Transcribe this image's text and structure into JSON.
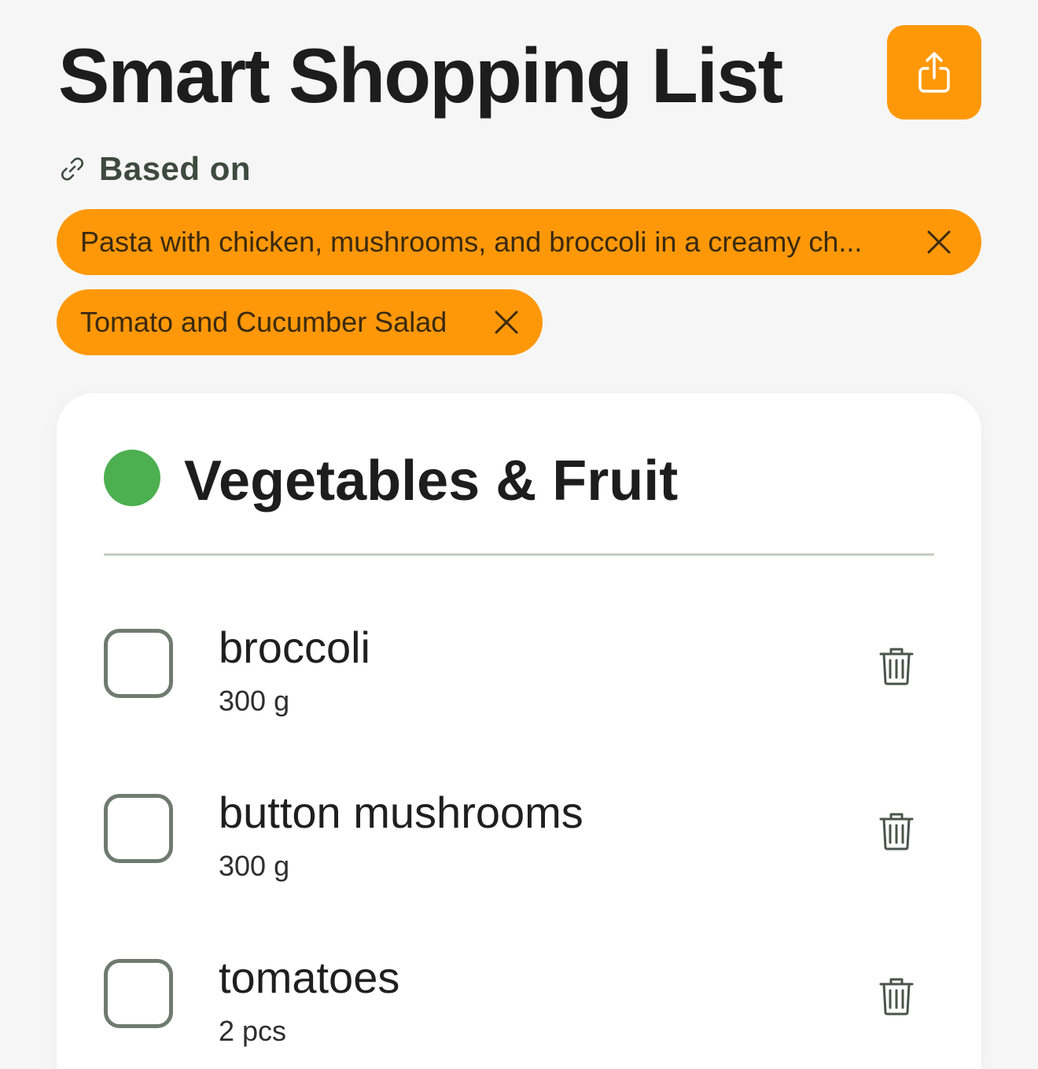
{
  "header": {
    "title": "Smart Shopping List",
    "share_icon": "share-icon",
    "accent_color": "#ff9808"
  },
  "based_on": {
    "label": "Based on",
    "icon": "link-icon",
    "recipes": [
      {
        "label": "Pasta with chicken, mushrooms, and broccoli in a creamy ch..."
      },
      {
        "label": "Tomato and Cucumber Salad"
      }
    ]
  },
  "category": {
    "title": "Vegetables & Fruit",
    "dot_color": "#4caf50",
    "items": [
      {
        "name": "broccoli",
        "quantity": "300 g",
        "checked": false
      },
      {
        "name": "button mushrooms",
        "quantity": "300 g",
        "checked": false
      },
      {
        "name": "tomatoes",
        "quantity": "2 pcs",
        "checked": false
      }
    ]
  }
}
